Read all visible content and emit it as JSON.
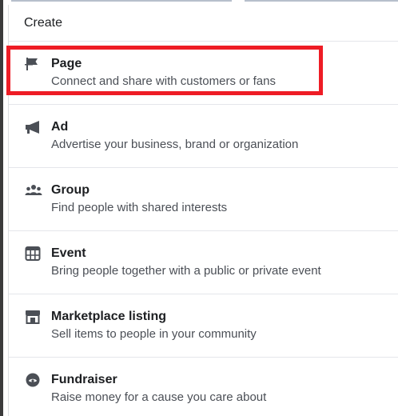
{
  "menu": {
    "header": "Create",
    "items": [
      {
        "title": "Page",
        "description": "Connect and share with customers or fans",
        "icon": "flag-icon"
      },
      {
        "title": "Ad",
        "description": "Advertise your business, brand or organization",
        "icon": "megaphone-icon"
      },
      {
        "title": "Group",
        "description": "Find people with shared interests",
        "icon": "group-icon"
      },
      {
        "title": "Event",
        "description": "Bring people together with a public or private event",
        "icon": "calendar-icon"
      },
      {
        "title": "Marketplace listing",
        "description": "Sell items to people in your community",
        "icon": "storefront-icon"
      },
      {
        "title": "Fundraiser",
        "description": "Raise money for a cause you care about",
        "icon": "fundraiser-icon"
      }
    ]
  },
  "highlight": {
    "target": "Page",
    "color": "#ee1c25"
  },
  "colors": {
    "title_text": "#1c1e21",
    "description_text": "#4b4f56",
    "icon": "#4b4f56",
    "divider": "#e4e6eb"
  }
}
